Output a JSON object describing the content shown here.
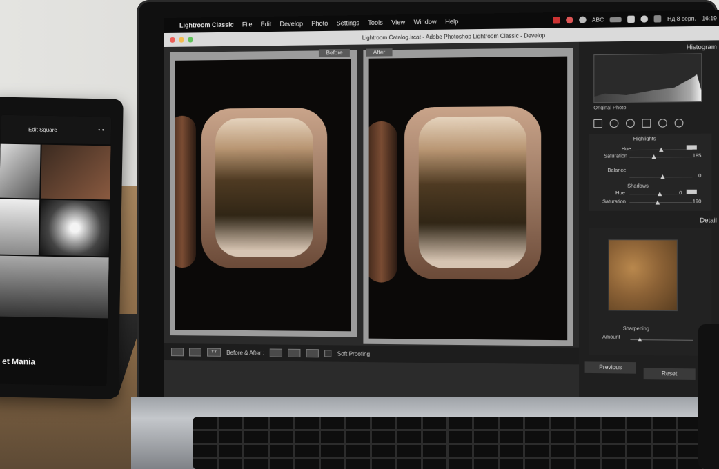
{
  "tablet": {
    "title": "Edit Square",
    "caption": "et Mania"
  },
  "menubar": {
    "app_name": "Lightroom Classic",
    "items": [
      "File",
      "Edit",
      "Develop",
      "Photo",
      "Settings",
      "Tools",
      "View",
      "Window",
      "Help"
    ],
    "keyboard_layout": "ABC",
    "date": "Нд 8 серп.",
    "time": "16:19"
  },
  "window": {
    "title": "Lightroom Catalog.lrcat - Adobe Photoshop Lightroom Classic - Develop"
  },
  "compare": {
    "before_label": "Before",
    "after_label": "After"
  },
  "toolbar": {
    "view_mode": "YY",
    "before_after_label": "Before & After :",
    "soft_proofing_label": "Soft Proofing"
  },
  "panel": {
    "histogram_title": "Histogram",
    "original_photo_label": "Original Photo",
    "highlights_title": "Highlights",
    "hue_label": "Hue",
    "saturation_label": "Saturation",
    "highlights_saturation": "185",
    "balance_label": "Balance",
    "balance_value": "0",
    "shadows_title": "Shadows",
    "shadows_hue_value": "0",
    "shadows_saturation": "190",
    "detail_title": "Detail",
    "sharpening_title": "Sharpening",
    "amount_label": "Amount",
    "amount_value": "0",
    "previous_button": "Previous",
    "reset_button": "Reset"
  },
  "colors": {
    "panel_bg": "#1f1f1f",
    "menubar_bg": "#0b0b0b",
    "titlebar_bg": "#dadada"
  }
}
